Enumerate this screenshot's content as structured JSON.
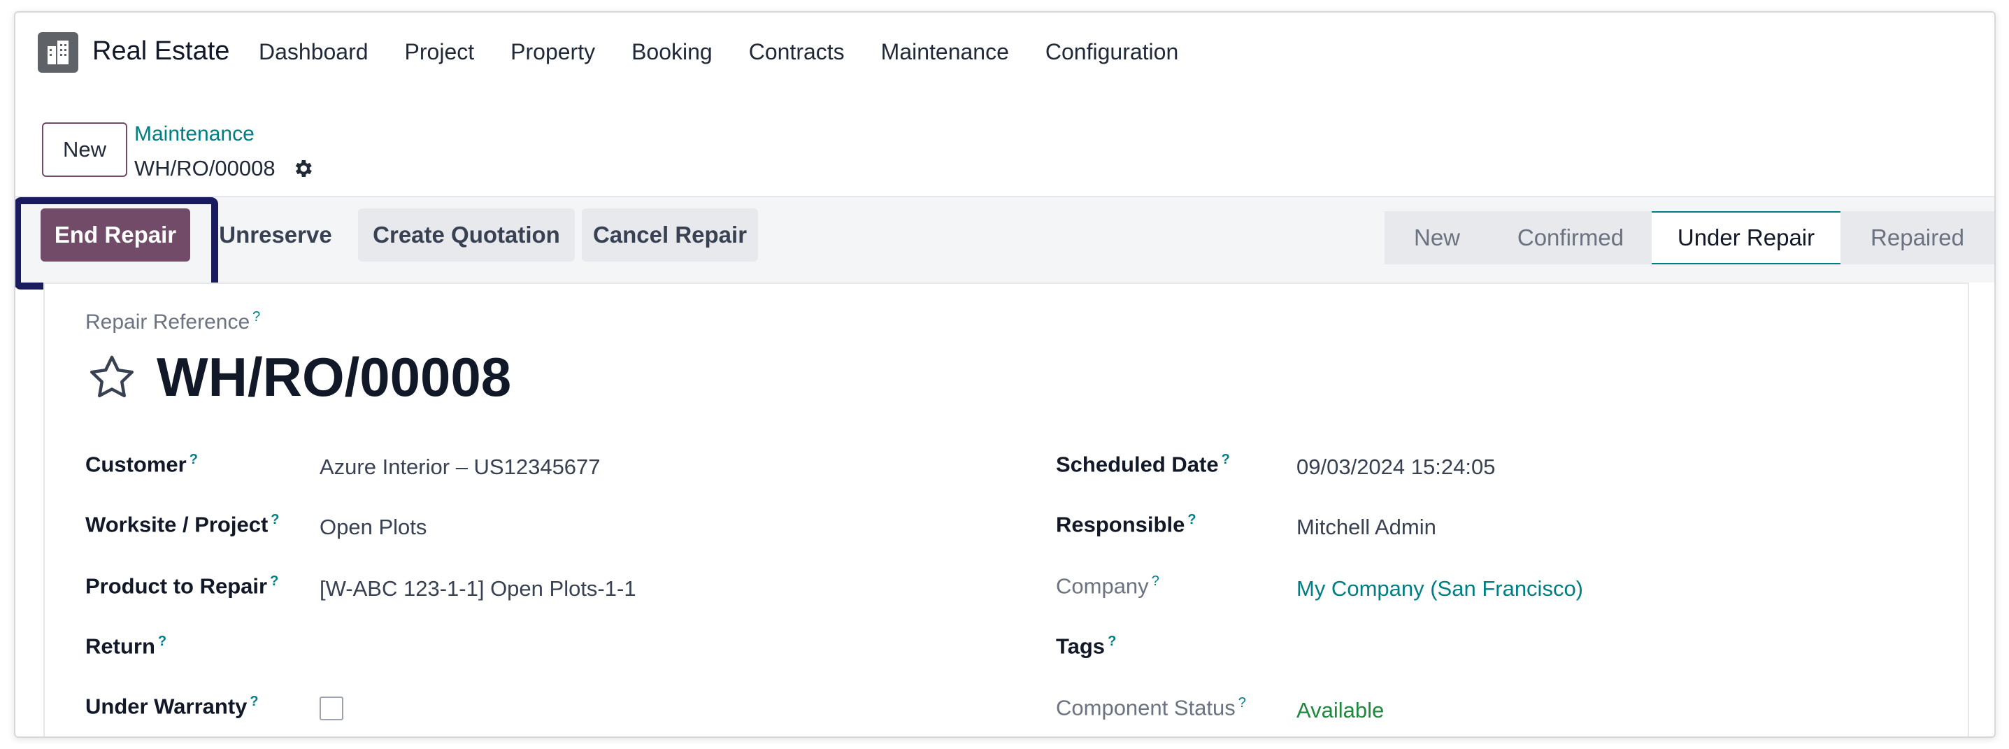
{
  "app": {
    "name": "Real Estate",
    "logo_icon": "building-icon"
  },
  "menu": [
    {
      "label": "Dashboard"
    },
    {
      "label": "Project"
    },
    {
      "label": "Property"
    },
    {
      "label": "Booking"
    },
    {
      "label": "Contracts"
    },
    {
      "label": "Maintenance"
    },
    {
      "label": "Configuration"
    }
  ],
  "control_panel": {
    "new_label": "New",
    "breadcrumb_parent": "Maintenance",
    "breadcrumb_current": "WH/RO/00008",
    "gear_icon": "gear-icon"
  },
  "actions": {
    "end_repair": "End Repair",
    "unreserve": "Unreserve",
    "create_quotation": "Create Quotation",
    "cancel_repair": "Cancel Repair"
  },
  "statusbar": {
    "stages": [
      {
        "label": "New",
        "active": false
      },
      {
        "label": "Confirmed",
        "active": false
      },
      {
        "label": "Under Repair",
        "active": true
      },
      {
        "label": "Repaired",
        "active": false
      }
    ]
  },
  "form": {
    "ref_label": "Repair Reference",
    "title": "WH/RO/00008",
    "help_mark": "?",
    "left": [
      {
        "label": "Customer",
        "value": "Azure Interior – US12345677"
      },
      {
        "label": "Worksite / Project",
        "value": "Open Plots"
      },
      {
        "label": "Product to Repair",
        "value": "[W-ABC 123-1-1] Open Plots-1-1"
      },
      {
        "label": "Return",
        "value": ""
      },
      {
        "label": "Under Warranty",
        "checked": false
      }
    ],
    "right": [
      {
        "label": "Scheduled Date",
        "value": "09/03/2024 15:24:05"
      },
      {
        "label": "Responsible",
        "value": "Mitchell Admin"
      },
      {
        "label": "Company",
        "value": "My Company (San Francisco)"
      },
      {
        "label": "Tags",
        "value": ""
      },
      {
        "label": "Component Status",
        "value": "Available"
      }
    ]
  },
  "colors": {
    "primary": "#714B67",
    "link": "#017e84",
    "available": "#1c8a3d",
    "highlight": "#1a1b5e"
  }
}
